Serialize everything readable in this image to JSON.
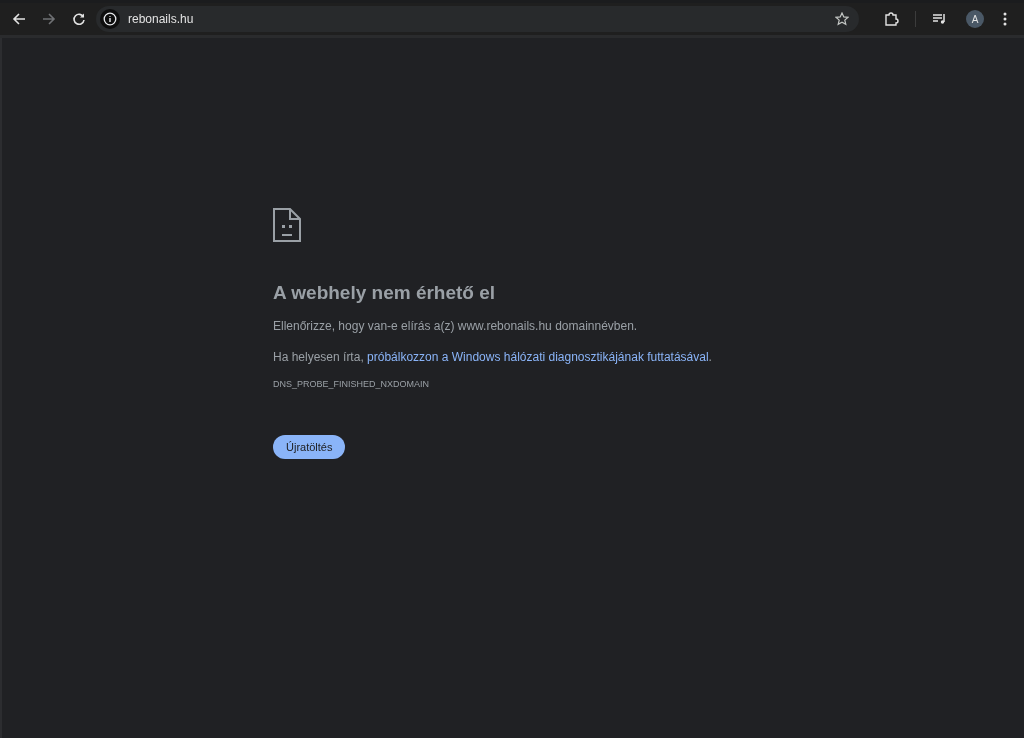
{
  "toolbar": {
    "back": {
      "disabled": false
    },
    "forward": {
      "disabled": true
    },
    "address": "rebonails.hu",
    "profile_initial": "A"
  },
  "error": {
    "title": "A webhely nem érhető el",
    "lines": [
      {
        "kind": "text",
        "text": "Ellenőrizze, hogy van-e elírás a(z) www.rebonails.hu domainnévben."
      },
      {
        "kind": "link",
        "text": "Ha helyesen írta, ",
        "link": "próbálkozzon a Windows hálózati diagnosztikájának futtatásával",
        "after": "."
      }
    ],
    "code": "DNS_PROBE_FINISHED_NXDOMAIN",
    "button": "Újratöltés"
  }
}
